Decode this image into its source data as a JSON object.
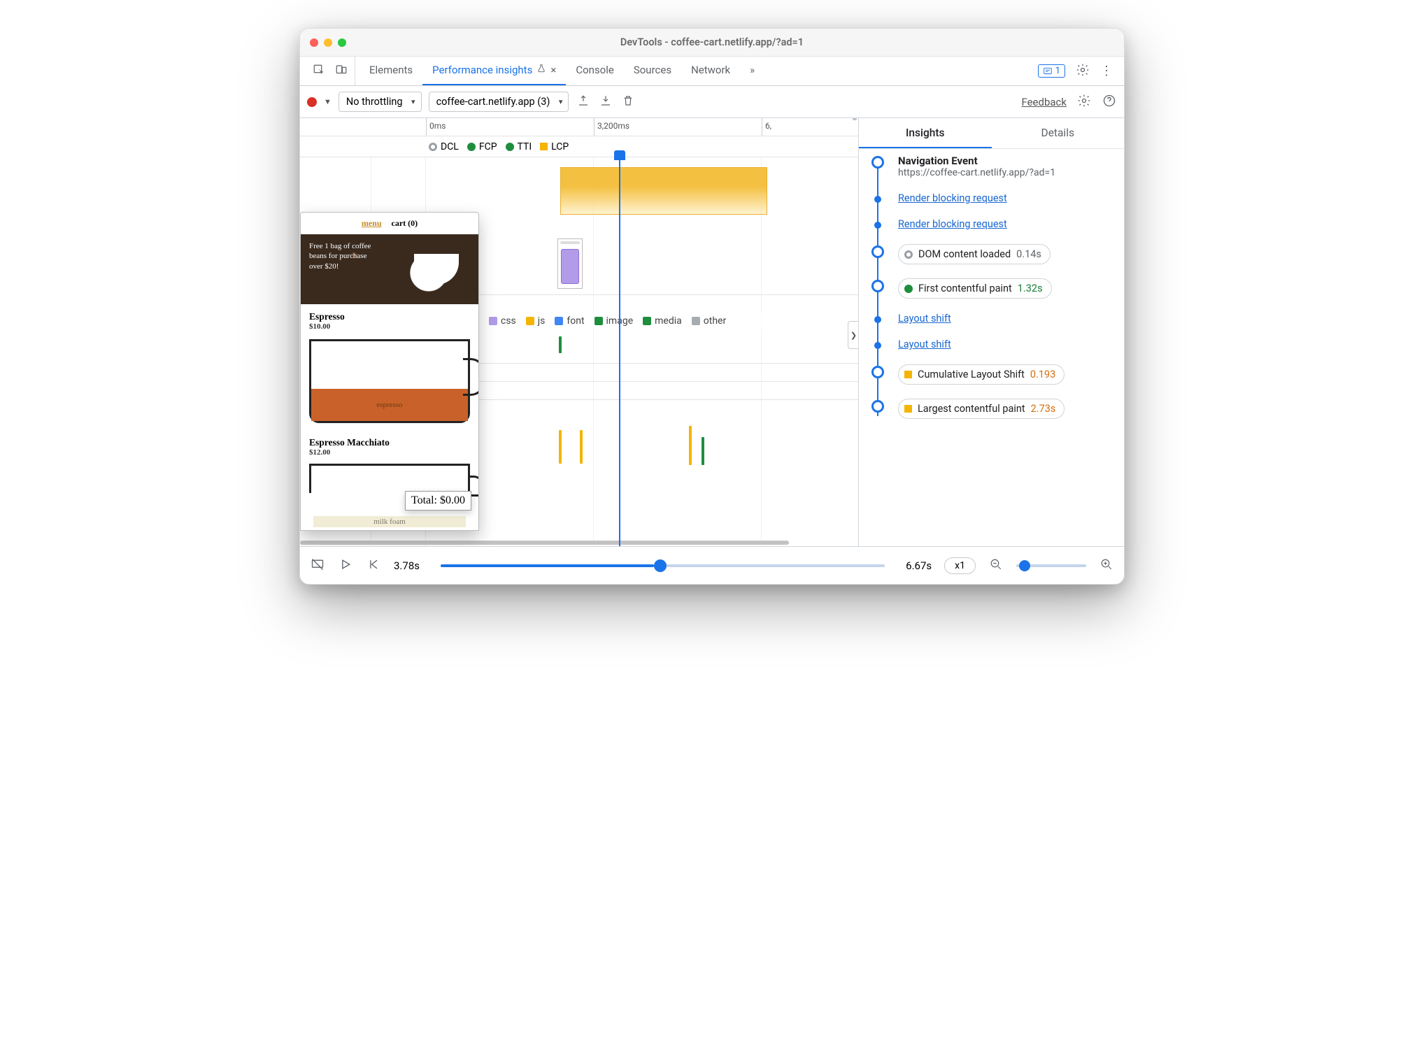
{
  "window": {
    "title": "DevTools - coffee-cart.netlify.app/?ad=1"
  },
  "tabs": {
    "items": [
      "Elements",
      "Performance insights",
      "Console",
      "Sources",
      "Network"
    ],
    "activeIndex": 1,
    "overflow_glyph": "»",
    "issues_count": "1"
  },
  "toolbar": {
    "throttling": "No throttling",
    "recording": "coffee-cart.netlify.app (3)",
    "feedback": "Feedback"
  },
  "timeline": {
    "ticks": [
      "0ms",
      "3,200ms",
      "6,"
    ],
    "markers": [
      {
        "label": "DCL",
        "type": "ring",
        "color": "#9aa0a6"
      },
      {
        "label": "FCP",
        "type": "dot",
        "color": "#1e8e3e"
      },
      {
        "label": "TTI",
        "type": "dot",
        "color": "#1e8e3e"
      },
      {
        "label": "LCP",
        "type": "square",
        "color": "#f4b400"
      }
    ],
    "legend": [
      {
        "label": "css",
        "color": "#b29be8"
      },
      {
        "label": "js",
        "color": "#f4b400"
      },
      {
        "label": "font",
        "color": "#4285f4"
      },
      {
        "label": "image",
        "color": "#1e8e3e"
      },
      {
        "label": "media",
        "color": "#1e8e3e"
      },
      {
        "label": "other",
        "color": "#a7acb1"
      }
    ]
  },
  "thumb": {
    "menu": "menu",
    "cart": "cart (0)",
    "banner": "Free 1 bag of coffee beans for purchase over $20!",
    "prod1": {
      "name": "Espresso",
      "price": "$10.00",
      "label": "espresso"
    },
    "prod2": {
      "name": "Espresso Macchiato",
      "price": "$12.00",
      "foam": "milk foam"
    },
    "total": "Total: $0.00"
  },
  "insights": {
    "tabs": [
      "Insights",
      "Details"
    ],
    "activeTab": 0,
    "nav": {
      "title": "Navigation Event",
      "url": "https://coffee-cart.netlify.app/?ad=1"
    },
    "items": [
      {
        "kind": "link",
        "text": "Render blocking request"
      },
      {
        "kind": "link",
        "text": "Render blocking request"
      },
      {
        "kind": "chip",
        "icon": "ring",
        "iconColor": "#9aa0a6",
        "text": "DOM content loaded",
        "value": "0.14s",
        "valueColor": "#5f6368"
      },
      {
        "kind": "chip",
        "icon": "dot",
        "iconColor": "#1e8e3e",
        "text": "First contentful paint",
        "value": "1.32s",
        "valueColor": "green"
      },
      {
        "kind": "link",
        "text": "Layout shift"
      },
      {
        "kind": "link",
        "text": "Layout shift"
      },
      {
        "kind": "chip",
        "icon": "square",
        "iconColor": "#f4b400",
        "text": "Cumulative Layout Shift",
        "value": "0.193",
        "valueColor": "orange"
      },
      {
        "kind": "chip",
        "icon": "square",
        "iconColor": "#f4b400",
        "text": "Largest contentful paint",
        "value": "2.73s",
        "valueColor": "orange"
      }
    ]
  },
  "footer": {
    "current": "3.78s",
    "total": "6.67s",
    "zoom": "x1"
  }
}
